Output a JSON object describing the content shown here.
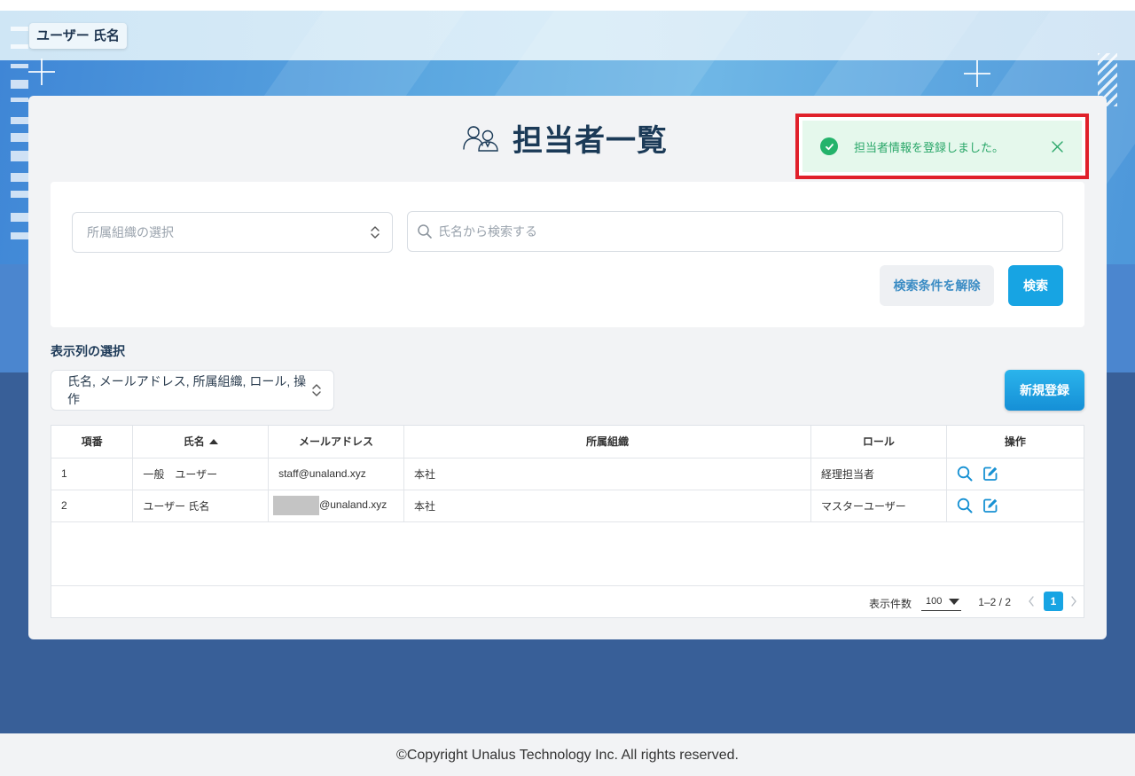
{
  "header": {
    "user_badge": "ユーザー 氏名"
  },
  "page": {
    "title": "担当者一覧"
  },
  "toast": {
    "message": "担当者情報を登録しました。"
  },
  "filters": {
    "org_placeholder": "所属組織の選択",
    "name_search_placeholder": "氏名から検索する",
    "clear_label": "検索条件を解除",
    "search_label": "検索"
  },
  "columns": {
    "label": "表示列の選択",
    "selected": "氏名, メールアドレス, 所属組織, ロール, 操作"
  },
  "new_button_label": "新規登録",
  "table": {
    "headers": {
      "no": "項番",
      "name": "氏名",
      "email": "メールアドレス",
      "org": "所属組織",
      "role": "ロール",
      "actions": "操作"
    },
    "rows": [
      {
        "no": "1",
        "name": "一般　ユーザー",
        "email": "staff@unaland.xyz",
        "org": "本社",
        "role": "経理担当者"
      },
      {
        "no": "2",
        "name": "ユーザー 氏名",
        "email": "@unaland.xyz",
        "org": "本社",
        "role": "マスターユーザー"
      }
    ]
  },
  "pagination": {
    "rows_label": "表示件数",
    "rows_per_page": "100",
    "range": "1–2 / 2",
    "current_page": "1"
  },
  "footer": {
    "copyright": "©Copyright Unalus Technology Inc. All rights reserved."
  },
  "colors": {
    "accent": "#17a4e3",
    "toast_green": "#24b36b",
    "toast_border": "#e0202a",
    "background_dark": "#385f98",
    "title": "#1b3a57"
  },
  "icons": [
    "people-icon",
    "check-circle-icon",
    "close-icon",
    "search-icon",
    "updown-chevron-icon",
    "magnifier-icon",
    "edit-icon",
    "chevron-left-icon",
    "chevron-right-icon"
  ]
}
